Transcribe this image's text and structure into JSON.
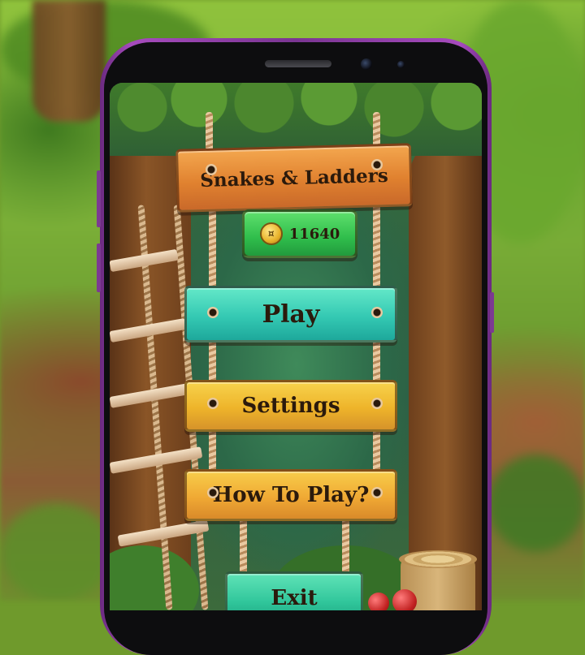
{
  "game": {
    "title": "Snakes & Ladders",
    "coins": "11640"
  },
  "menu": {
    "play_label": "Play",
    "settings_label": "Settings",
    "how_to_play_label": "How To Play?",
    "exit_label": "Exit"
  },
  "colors": {
    "title_sign": "#e0812f",
    "coin_sign": "#2fbd4b",
    "play_sign": "#34c9b3",
    "settings_sign": "#eeb42a",
    "how_sign": "#f0a934",
    "exit_sign": "#2fc59a",
    "phone_frame": "#a64bbd"
  },
  "icons": {
    "coin": "coin-icon"
  }
}
